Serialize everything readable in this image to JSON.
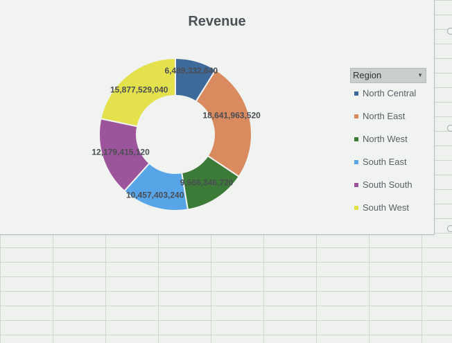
{
  "chart_data": {
    "type": "pie",
    "style": "donut",
    "title": "Revenue",
    "legend": {
      "title": "Region",
      "placement": "right"
    },
    "categories": [
      "North Central",
      "North East",
      "North West",
      "South East",
      "South South",
      "South West"
    ],
    "values": [
      6489332640,
      18641963520,
      9566346720,
      10457403240,
      12179415120,
      15877529040
    ],
    "data_labels": [
      "6,489,332,640",
      "18,641,963,520",
      "9,566,346,720",
      "10,457,403,240",
      "12,179,415,120",
      "15,877,529,040"
    ],
    "colors": [
      "#3e6a9b",
      "#d98a5e",
      "#3c7a37",
      "#57a4e6",
      "#9c549a",
      "#e3e24d"
    ]
  }
}
